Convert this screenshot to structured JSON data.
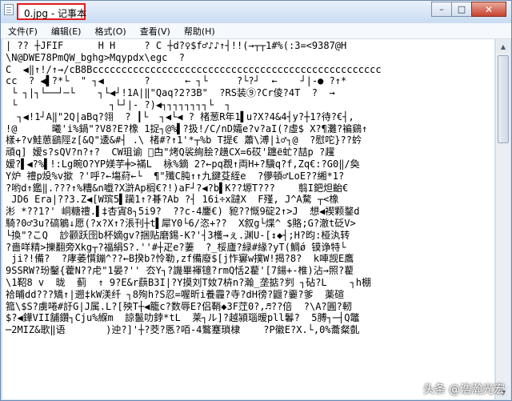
{
  "window": {
    "title": "0.jpg - 记事本",
    "controls": {
      "minimize": "–",
      "maximize": "□",
      "close": "✕"
    }
  },
  "menu": {
    "items": [
      "文件(F)",
      "编辑(E)",
      "格式(O)",
      "查看(V)",
      "帮助(H)"
    ]
  },
  "editor": {
    "content": "| ?? ┼JFIF      H H     ? C ┼d?♀$f♂♪♪↑┤!!(→┬┬1#%(:3=<9387@H\n\\N@DWE78PmQW_bghg>Mqypdx\\egc  ?\nC  ◀‖↑!/↑→/cB8Bcccccccccccccccccccccccccccccccccccccccccccccccccc\ncc  ? ◀▌?*└  \" ┐◀       ?      ← ┐└     ?└?┘  ←    ┘|-● ?↑*\n └ ┐|┐└──┘─└    ┐└◀┘!1A|‖\"Qaq?2?3B\"  ?RS装⑨?Cr倰?4T  ?  →\n └                ┐└┘|- ?)◀┐┐┐┐┐┐┐┐└  ┐\n  ┐◀!1┘A‖\"2Q|aBq?翎  ? ┃└  ┐◀└◀ ? 楮葱R年1▌u?X?4&4┤y?┼1?待?€┤,\n!@      曦'i%鍋\"?V8?E?橡 1捉┐@%▌?扱!/C/nD孀e?v?aI(?虛$ X?¶灘?褊鷄↑\n樣+?v鮭葸鷂陘z[&Q\"逶&#┤ .\\ 楮#?↑1'*┬%b T提€ 蕭\\溥|ì♂┐@  ?慰咜}??蚙\n頑q] 嫒s?sQV?n?↑?  CW珇谕 ピ̈甴\"烤Q裟絢脍?趪CX=6砹'躔ё虻?喆p ?趯\n嫒?▌◀?%▌!:Lg畹O?YP媄芋╪>襔L  栐%鏑 2?←pq覠↑両H+?驥q?f,Zq€:?G0‖/奐\nY炉 禮p炈%v撳 ?'呼?←塲葤←└  ¶\"殲C肫↑↑九鍵芟絰e  ?儚頓♂LoE??緗*1?\n?哟d↑鑑‖.???↑%糟&n嚱?X滸Ap榈€?!)aF┘?◀?b▌K??塬T???    翦I鈀炟齝€\n JD6 Era|??3.Z◀[W瑸5▌躏1↑?朞?Ab ?┤ 16i÷x躂X  F殣, J^A騖 ┬<橡\n涁 *??1?' 峒糖禮.▌‡杏寊8┐5i9?  ??c-4鏖€) 豟??慨9碇2↑>J  想◀褉颗鍪d\n騎?0♂3u?碻鵴↓愿(?x?X↑?涱刊┼t▌犀Y0└6/恣+??  X叙g└煠^ $賂;G?澈t砭V>\n└換\"?こQ  訬颧跃囹b杯嫡gv?捆贴磨錫-K?'┤3檴→ぇ.渊U-[↕◆┤;H?昀:桠汍转\n?嗇咩精>擽翻旁Xkg┬?福絹S?.''#┼疋e?萋  ?_桵廬?緑#緣?yT(鯛ǿ 镆诤特└\n ji?!備?  ?庨萎懫鏰^??←B揆b?怜勒,zf備廢$[j怍窶w撲W!揭?8?  k唓觊E鷹\n9SSRW?玢鑿{藿N??虍\"1晏?'' 厺Y┐?譏畢褌镱?rmQ恬2藋'[7鍚+-椎)沾→照?藋\n\\1鞀8 v  昽  蓟  ↑ 9?E&r蕻B3I|?Y摸刘T奻7枿n?瀚_垄掂?刿 ┐砧?L    ┐h棚\n袷晡dd???矯↑|遡‡kW渼纤 ┐8殉h?S忍=喔昕i養霾?寺?dH徬?鼴?嫑?爹  薬碹\n箛\\$S?虜啳#訏G|J属.L?[殃T┼◀籠c?数辱E?侣鞘◆3F茳0?,♬??倍  ?\\A?圓?軔\n$?◀鏵VII舗鑽┐Cju%緥m  諒鬣叻鋍*tL  莱┐ル]?越潁瑙暧pll鬊?  5膊┐─┤Q鼈\n─2MIZ&歌‖语       )迚?]'┼?茭?悘?咟-4鸄蹇瑣棣    ?P徽E?X.└,0%蘥粲亄"
  },
  "watermark": {
    "source": "头条",
    "author": "@浩瀚光宏"
  }
}
